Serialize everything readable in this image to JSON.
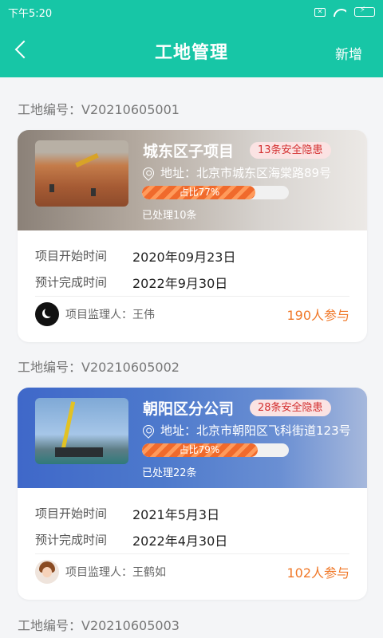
{
  "status_bar": {
    "time": "下午5:20",
    "sim_label": "✕"
  },
  "nav": {
    "title": "工地管理",
    "add_label": "新增"
  },
  "colors": {
    "primary": "#17c6a6",
    "hazard_text": "#d32f2f",
    "accent_orange": "#f07828"
  },
  "sites": [
    {
      "code_label": "工地编号：V20210605001",
      "name": "城东区子项目",
      "hazard": "13条安全隐患",
      "address_prefix": "地址：",
      "address": "北京市城东区海棠路89号",
      "progress_percent": 77,
      "progress_label": "占比77%",
      "handled": "已处理10条",
      "start_label": "项目开始时间",
      "start_value": "2020年09月23日",
      "end_label": "预计完成时间",
      "end_value": "2022年9月30日",
      "supervisor": "项目监理人：王伟",
      "participants": "190人参与"
    },
    {
      "code_label": "工地编号：V20210605002",
      "name": "朝阳区分公司",
      "hazard": "28条安全隐患",
      "address_prefix": "地址：",
      "address": "北京市朝阳区飞科街道123号",
      "progress_percent": 79,
      "progress_label": "占比79%",
      "handled": "已处理22条",
      "start_label": "项目开始时间",
      "start_value": "2021年5月3日",
      "end_label": "预计完成时间",
      "end_value": "2022年4月30日",
      "supervisor": "项目监理人：王鹤如",
      "participants": "102人参与"
    },
    {
      "code_label": "工地编号：V20210605003"
    }
  ]
}
